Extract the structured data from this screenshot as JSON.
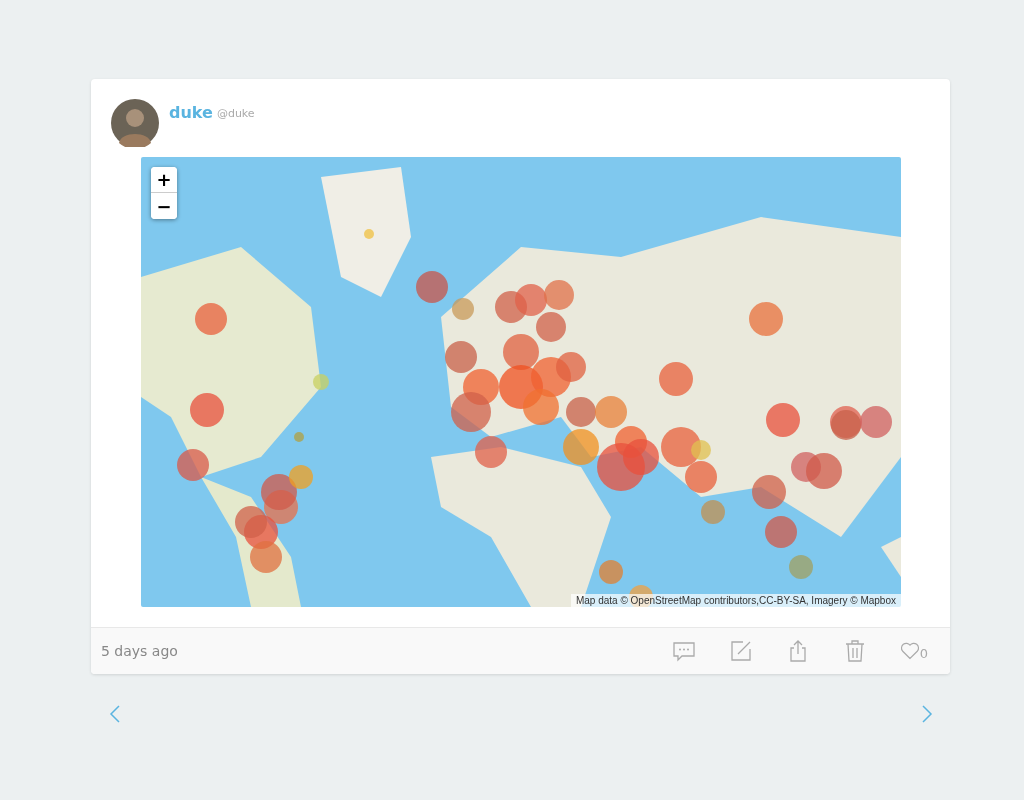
{
  "post": {
    "author": {
      "name": "duke",
      "handle": "@duke"
    },
    "map": {
      "zoom_in": "+",
      "zoom_out": "−",
      "attribution": "Map data © OpenStreetMap contributors,CC-BY-SA, Imagery © Mapbox"
    },
    "timestamp": "5 days ago",
    "likes": "0"
  }
}
